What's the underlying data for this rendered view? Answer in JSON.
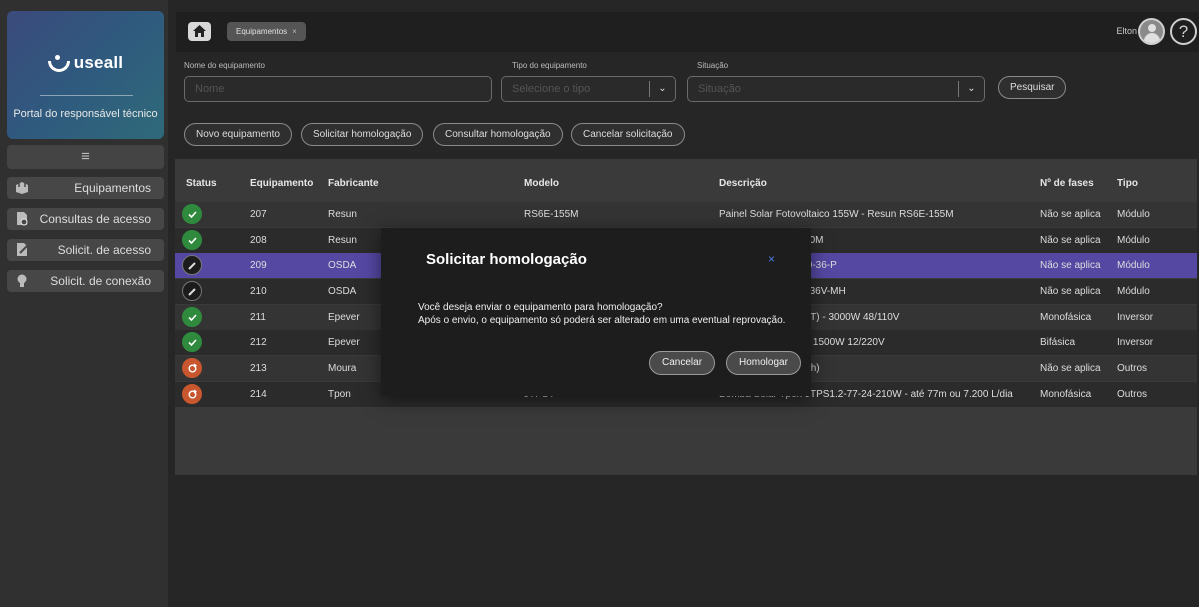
{
  "sidebar": {
    "brand": "useall",
    "portal_label": "Portal do responsável técnico",
    "menu_icon": "≡",
    "items": [
      {
        "label": "Equipamentos",
        "icon": "equipment-icon"
      },
      {
        "label": "Consultas de acesso",
        "icon": "document-search-icon"
      },
      {
        "label": "Solicit. de acesso",
        "icon": "document-edit-icon"
      },
      {
        "label": "Solicit. de conexão",
        "icon": "lightbulb-icon"
      }
    ]
  },
  "topbar": {
    "tab_label": "Equipamentos",
    "tab_close": "×",
    "user_name": "Elton",
    "help_symbol": "?"
  },
  "filters": {
    "name_label": "Nome do equipamento",
    "name_placeholder": "Nome",
    "type_label": "Tipo do equipamento",
    "type_placeholder": "Selecione o tipo",
    "status_label": "Situação",
    "status_placeholder": "Situação",
    "caret": "⌄",
    "search_button": "Pesquisar"
  },
  "actions": {
    "new": "Novo equipamento",
    "request": "Solicitar homologação",
    "consult": "Consultar homologação",
    "cancel": "Cancelar solicitação"
  },
  "table": {
    "headers": [
      "Status",
      "Equipamento",
      "Fabricante",
      "Modelo",
      "Descrição",
      "Nº de fases",
      "Tipo"
    ],
    "rows": [
      {
        "status": "ok",
        "id": "207",
        "maker": "Resun",
        "model": "RS6E-155M",
        "desc": "Painel Solar Fotovoltaico 155W - Resun RS6E-155M",
        "phases": "Não se aplica",
        "type": "Módulo"
      },
      {
        "status": "ok",
        "id": "208",
        "maker": "Resun",
        "model": "",
        "desc": "W - Resun RS7E-210M",
        "phases": "Não se aplica",
        "type": "Módulo"
      },
      {
        "status": "edit",
        "id": "209",
        "maker": "OSDA",
        "model": "",
        "desc": "W - OSDA - ODA330-36-P",
        "phases": "Não se aplica",
        "type": "Módulo"
      },
      {
        "status": "edit",
        "id": "210",
        "maker": "OSDA",
        "model": "",
        "desc": "W - OSDA ODA465-36V-MH",
        "phases": "Não se aplica",
        "type": "Módulo"
      },
      {
        "status": "ok",
        "id": "211",
        "maker": "Epever",
        "model": "",
        "desc": "ver Plus IP3000-41 (T) - 3000W 48/110V",
        "phases": "Monofásica",
        "type": "Inversor"
      },
      {
        "status": "ok",
        "id": "212",
        "maker": "Epever",
        "model": "",
        "desc": "ver Plus IP1500-12 - 1500W 12/220V",
        "phases": "Bifásica",
        "type": "Inversor"
      },
      {
        "status": "sync",
        "id": "213",
        "maker": "Moura",
        "model": "",
        "desc": "olar 12MS234 (220Ah)",
        "phases": "Não se aplica",
        "type": "Outros"
      },
      {
        "status": "sync",
        "id": "214",
        "maker": "Tpon",
        "model": "JTPSY",
        "desc": "Bomba Solar Tpon JTPS1.2-77-24-210W - até 77m ou 7.200 L/dia",
        "phases": "Monofásica",
        "type": "Outros"
      }
    ]
  },
  "modal": {
    "title": "Solicitar homologação",
    "close": "×",
    "line1": "Você deseja enviar o equipamento para homologação?",
    "line2": "Após o envio, o equipamento só poderá ser alterado em uma eventual reprovação.",
    "cancel": "Cancelar",
    "confirm": "Homologar"
  }
}
